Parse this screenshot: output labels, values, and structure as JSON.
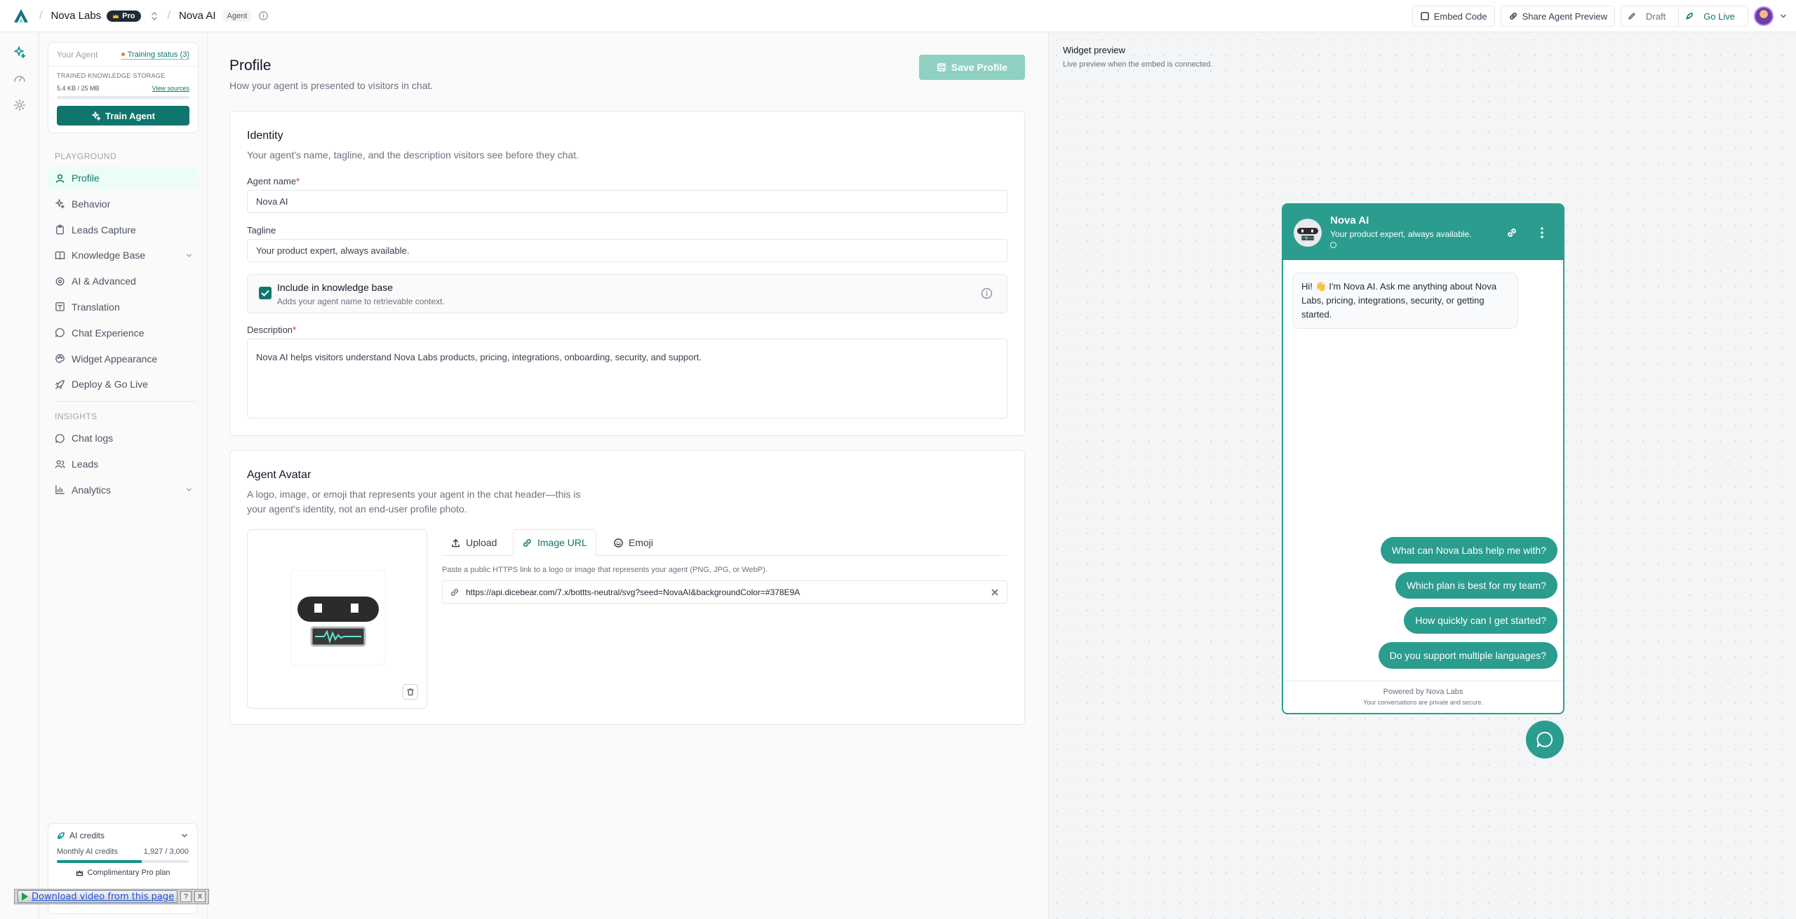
{
  "topbar": {
    "org_name": "Nova Labs",
    "plan_badge": "Pro",
    "agent_name": "Nova AI",
    "agent_tag": "Agent",
    "embed_code": "Embed Code",
    "share_preview": "Share Agent Preview",
    "draft": "Draft",
    "go_live": "Go Live"
  },
  "rail": {
    "icons": [
      "sparkles-icon",
      "gauge-icon",
      "gear-icon"
    ]
  },
  "sidebar": {
    "agent_card": {
      "label": "Your Agent",
      "training_status": "Training status (3)",
      "storage_label": "TRAINED KNOWLEDGE STORAGE",
      "storage_value": "5.4 KB / 25 MB",
      "view_sources": "View sources",
      "storage_fraction": 0.0002,
      "train_button": "Train Agent"
    },
    "playground_title": "PLAYGROUND",
    "playground_items": [
      {
        "label": "Profile",
        "icon": "user-icon",
        "active": true
      },
      {
        "label": "Behavior",
        "icon": "sparkles-icon"
      },
      {
        "label": "Leads Capture",
        "icon": "clipboard-icon"
      },
      {
        "label": "Knowledge Base",
        "icon": "book-icon",
        "expandable": true
      },
      {
        "label": "AI & Advanced",
        "icon": "gear-icon"
      },
      {
        "label": "Translation",
        "icon": "translate-icon"
      },
      {
        "label": "Chat Experience",
        "icon": "chat-icon"
      },
      {
        "label": "Widget Appearance",
        "icon": "palette-icon"
      },
      {
        "label": "Deploy & Go Live",
        "icon": "rocket-icon"
      }
    ],
    "insights_title": "INSIGHTS",
    "insights_items": [
      {
        "label": "Chat logs",
        "icon": "chat-icon"
      },
      {
        "label": "Leads",
        "icon": "users-icon"
      },
      {
        "label": "Analytics",
        "icon": "bar-chart-icon",
        "expandable": true
      }
    ],
    "credits": {
      "title": "AI credits",
      "monthly_label": "Monthly AI credits",
      "monthly_value": "1,927 / 3,000",
      "used_fraction": 0.642,
      "plan": "Complimentary Pro plan"
    }
  },
  "download_bar": {
    "label": "Download video from this page",
    "help": "?",
    "close": "X"
  },
  "main": {
    "title": "Profile",
    "subtitle": "How your agent is presented to visitors in chat.",
    "save_button": "Save Profile",
    "identity": {
      "title": "Identity",
      "subtitle": "Your agent's name, tagline, and the description visitors see before they chat.",
      "name_label": "Agent name",
      "name_value": "Nova AI",
      "tagline_label": "Tagline",
      "tagline_value": "Your product expert, always available.",
      "kb_title": "Include in knowledge base",
      "kb_sub": "Adds your agent name to retrievable context.",
      "kb_checked": true,
      "description_label": "Description",
      "description_value": "Nova AI helps visitors understand Nova Labs products, pricing, integrations, onboarding, security, and support.",
      "required_mark": "*"
    },
    "avatar": {
      "title": "Agent Avatar",
      "subtitle_line1": "A logo, image, or emoji that represents your agent in the chat header—this is",
      "subtitle_line2": "your agent's identity, not an end-user profile photo.",
      "tabs": [
        "Upload",
        "Image URL",
        "Emoji"
      ],
      "active_tab": "Image URL",
      "url_help": "Paste a public HTTPS link to a logo or image that represents your agent (PNG, JPG, or WebP).",
      "url_value": "https://api.dicebear.com/7.x/bottts-neutral/svg?seed=NovaAI&backgroundColor=#378E9A"
    }
  },
  "preview": {
    "title": "Widget preview",
    "subtitle": "Live preview when the embed is connected.",
    "widget": {
      "name": "Nova AI",
      "tagline": "Your product expert, always available.",
      "greeting": "Hi! 👋 I'm Nova AI. Ask me anything about Nova Labs, pricing, integrations, security, or getting started.",
      "suggestions": [
        "What can Nova Labs help me with?",
        "Which plan is best for my team?",
        "How quickly can I get started?",
        "Do you support multiple languages?"
      ],
      "powered_by": "Powered by Nova Labs",
      "privacy": "Your conversations are private and secure."
    }
  },
  "colors": {
    "accent": "#0f766e",
    "widget": "#2a9d8f",
    "save_disabled": "#8fd1c2"
  }
}
